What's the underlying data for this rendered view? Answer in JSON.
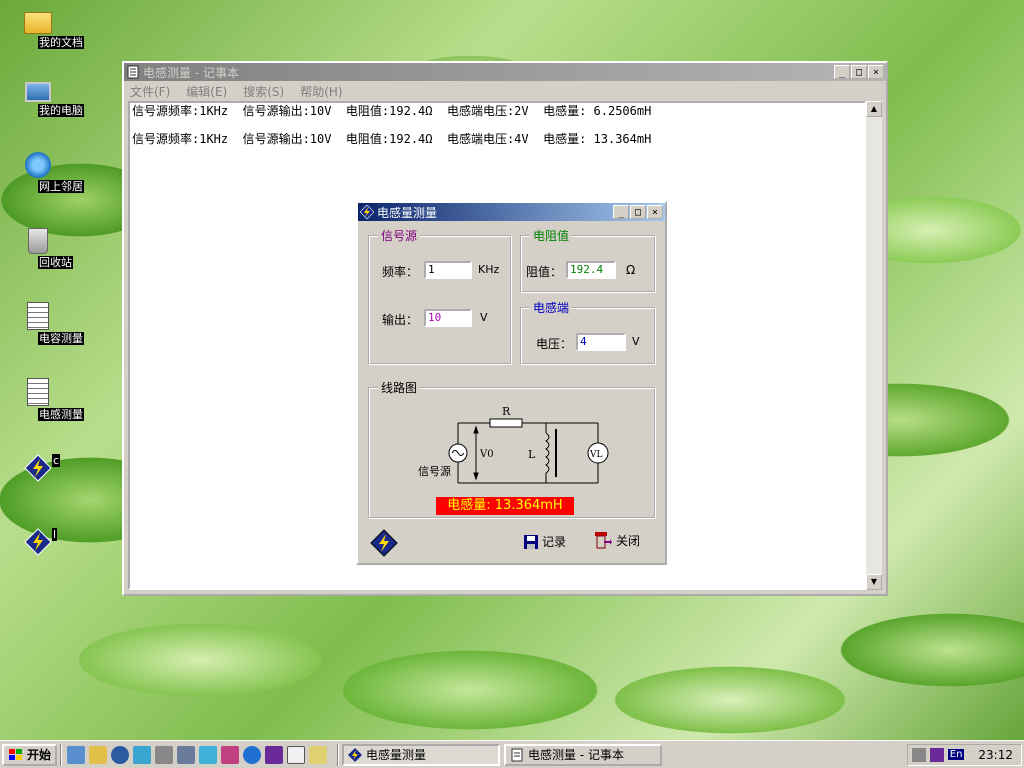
{
  "desktop": {
    "icons": [
      {
        "label": "我的文档"
      },
      {
        "label": "我的电脑"
      },
      {
        "label": "网上邻居"
      },
      {
        "label": "回收站"
      },
      {
        "label": "电容测量"
      },
      {
        "label": "电感测量"
      },
      {
        "label": "c"
      },
      {
        "label": "l"
      }
    ]
  },
  "notepad": {
    "title": "电感测量 - 记事本",
    "menu": [
      "文件(F)",
      "编辑(E)",
      "搜索(S)",
      "帮助(H)"
    ],
    "lines": [
      "信号源频率:1KHz  信号源输出:10V  电阻值:192.4Ω  电感端电压:2V  电感量: 6.2506mH",
      "信号源频率:1KHz  信号源输出:10V  电阻值:192.4Ω  电感端电压:4V  电感量: 13.364mH"
    ]
  },
  "dialog": {
    "title": "电感量测量",
    "signal_group": "信号源",
    "freq_label": "频率：",
    "freq_value": "1",
    "freq_unit": "KHz",
    "output_label": "输出：",
    "output_value": "10",
    "output_unit": "V",
    "resist_group": "电阻值",
    "resist_label": "阻值：",
    "resist_value": "192.4",
    "resist_unit": "Ω",
    "ind_group": "电感端",
    "volt_label": "电压：",
    "volt_value": "4",
    "volt_unit": "V",
    "circuit_group": "线路图",
    "circuit": {
      "r_label": "R",
      "l_label": "L",
      "v0_label": "V0",
      "vl_label": "VL",
      "src_label": "信号源"
    },
    "result": "电感量: 13.364mH",
    "record_btn": "记录",
    "close_btn": "关闭"
  },
  "taskbar": {
    "start": "开始",
    "tasks": [
      "电感量测量",
      "电感测量 - 记事本"
    ],
    "lang": "En",
    "clock": "23:12"
  },
  "colors": {
    "title_active": "#0a246a",
    "window_bg": "#d4d0c8",
    "result_bg": "#ff0000",
    "result_fg": "#ffff00",
    "group_purple": "#800080",
    "group_green": "#008000",
    "group_blue": "#0000c0"
  }
}
